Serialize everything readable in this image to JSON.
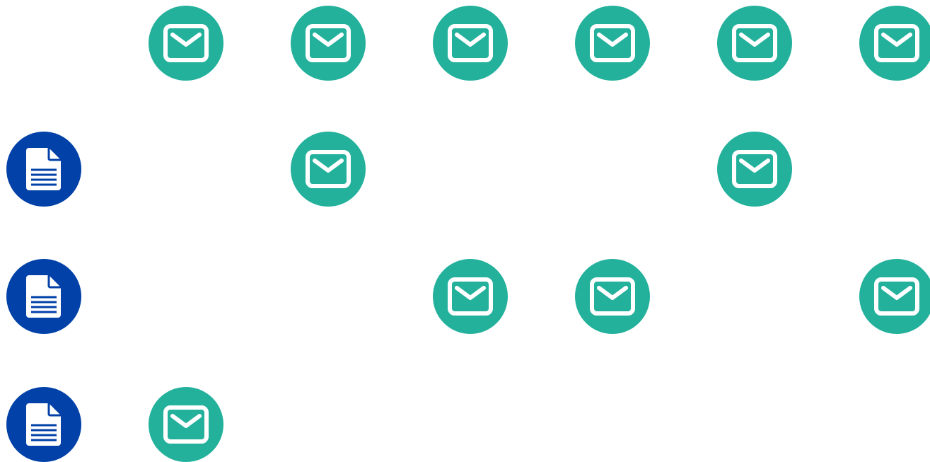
{
  "colors": {
    "background": "#ffffff",
    "document": "#0241a8",
    "mail": "#23b19c",
    "glyph": "#ffffff"
  },
  "icons": {
    "document": "document-icon",
    "mail": "mail-icon"
  },
  "grid": [
    [
      null,
      "mail",
      "mail",
      "mail",
      "mail",
      "mail",
      "mail"
    ],
    [
      "document",
      null,
      "mail",
      null,
      null,
      "mail",
      null
    ],
    [
      "document",
      null,
      null,
      "mail",
      "mail",
      null,
      "mail"
    ],
    [
      "document",
      "mail",
      null,
      null,
      null,
      null,
      null
    ]
  ]
}
